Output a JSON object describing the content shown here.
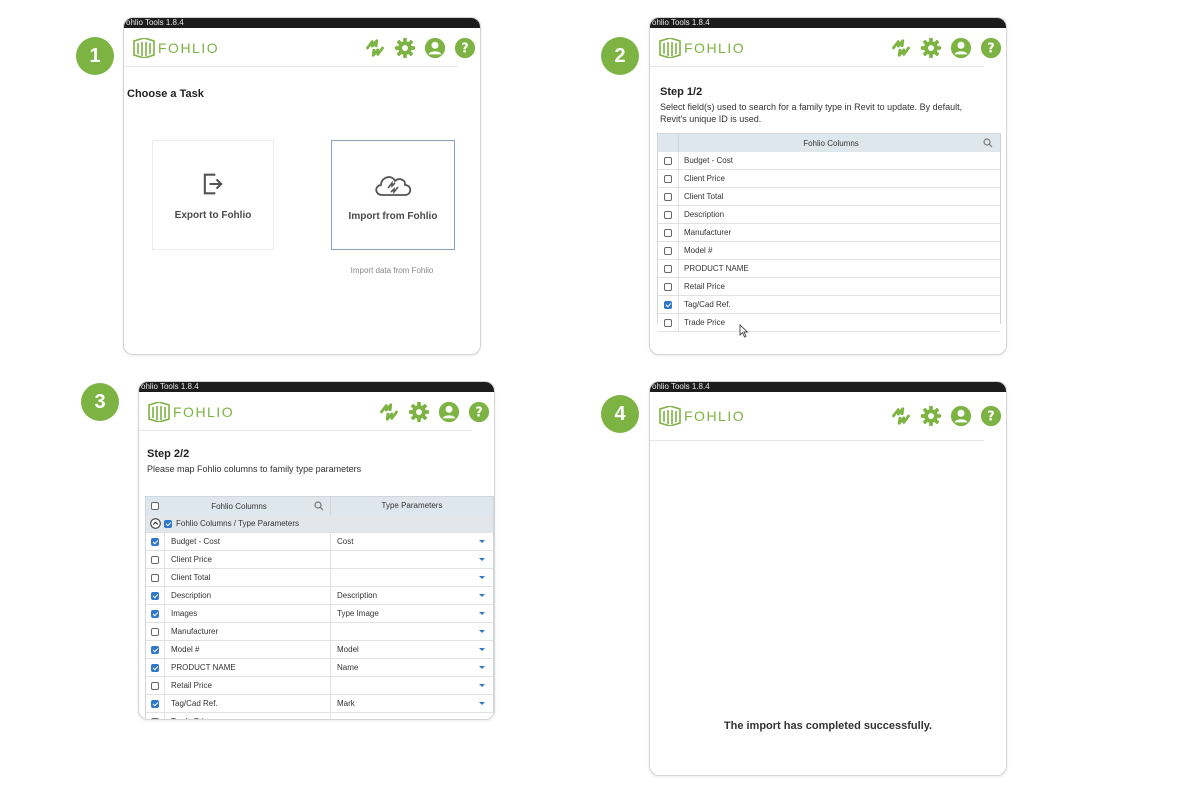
{
  "app": {
    "title": "ohlio Tools 1.8.4",
    "brand": "FOHLIO"
  },
  "colors": {
    "brand": "#7db343",
    "checkbox": "#2f77c9",
    "titlebar": "#1c1c1c"
  },
  "header_icons": [
    "sync-icon",
    "gear-icon",
    "user-icon",
    "help-icon"
  ],
  "badges": [
    "1",
    "2",
    "3",
    "4"
  ],
  "panel1": {
    "heading": "Choose a Task",
    "export_label": "Export to Fohlio",
    "import_label": "Import from Fohlio",
    "import_hint": "Import data from Fohlio"
  },
  "panel2": {
    "step": "Step 1/2",
    "desc_line1": "Select field(s) used to search for a family type in Revit to update. By default,",
    "desc_line2": "Revit's unique ID is used.",
    "column_header": "Fohlio Columns",
    "rows": [
      {
        "label": "Budget - Cost",
        "checked": false
      },
      {
        "label": "Client Price",
        "checked": false
      },
      {
        "label": "Client Total",
        "checked": false
      },
      {
        "label": "Description",
        "checked": false
      },
      {
        "label": "Manufacturer",
        "checked": false
      },
      {
        "label": "Model #",
        "checked": false
      },
      {
        "label": "PRODUCT NAME",
        "checked": false
      },
      {
        "label": "Retail Price",
        "checked": false
      },
      {
        "label": "Tag/Cad Ref.",
        "checked": true
      },
      {
        "label": "Trade Price",
        "checked": false
      }
    ]
  },
  "panel3": {
    "step": "Step 2/2",
    "desc": "Please map Fohlio columns to family type parameters",
    "col1_header": "Fohlio Columns",
    "col2_header": "Type Parameters",
    "group_label": "Fohlio Columns / Type Parameters",
    "rows": [
      {
        "label": "Budget - Cost",
        "checked": true,
        "param": "Cost"
      },
      {
        "label": "Client Price",
        "checked": false,
        "param": ""
      },
      {
        "label": "Client Total",
        "checked": false,
        "param": ""
      },
      {
        "label": "Description",
        "checked": true,
        "param": "Description"
      },
      {
        "label": "Images",
        "checked": true,
        "param": "Type Image"
      },
      {
        "label": "Manufacturer",
        "checked": false,
        "param": ""
      },
      {
        "label": "Model #",
        "checked": true,
        "param": "Model"
      },
      {
        "label": "PRODUCT NAME",
        "checked": true,
        "param": "Name"
      },
      {
        "label": "Retail Price",
        "checked": false,
        "param": ""
      },
      {
        "label": "Tag/Cad Ref.",
        "checked": true,
        "param": "Mark"
      },
      {
        "label": "Trade Price",
        "checked": false,
        "param": ""
      }
    ]
  },
  "panel4": {
    "message": "The import has completed successfully."
  }
}
